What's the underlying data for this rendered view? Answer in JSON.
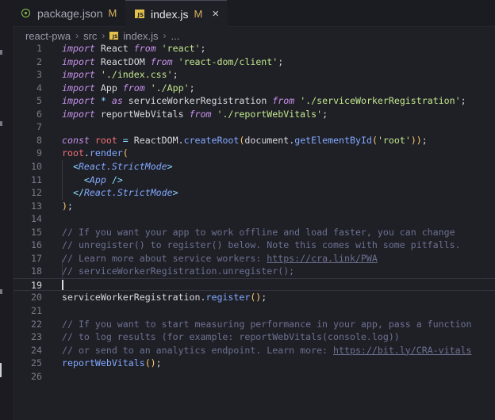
{
  "tabs": [
    {
      "label": "package.json",
      "status": "M",
      "icon": "node-icon"
    },
    {
      "label": "index.js",
      "status": "M",
      "icon": "js-icon",
      "active": true,
      "close": "×"
    }
  ],
  "breadcrumb": {
    "items": [
      "react-pwa",
      "src",
      "index.js",
      "..."
    ],
    "separator": "›"
  },
  "editor": {
    "current_line": 19,
    "lines": [
      {
        "n": "1",
        "tokens": [
          [
            "kw",
            "import"
          ],
          [
            "pl",
            " React "
          ],
          [
            "kw",
            "from"
          ],
          [
            "pl",
            " "
          ],
          [
            "st",
            "'react'"
          ],
          [
            "pl",
            ";"
          ]
        ]
      },
      {
        "n": "2",
        "tokens": [
          [
            "kw",
            "import"
          ],
          [
            "pl",
            " ReactDOM "
          ],
          [
            "kw",
            "from"
          ],
          [
            "pl",
            " "
          ],
          [
            "st",
            "'react-dom/client'"
          ],
          [
            "pl",
            ";"
          ]
        ]
      },
      {
        "n": "3",
        "tokens": [
          [
            "kw",
            "import"
          ],
          [
            "pl",
            " "
          ],
          [
            "st",
            "'./index.css'"
          ],
          [
            "pl",
            ";"
          ]
        ]
      },
      {
        "n": "4",
        "tokens": [
          [
            "kw",
            "import"
          ],
          [
            "pl",
            " App "
          ],
          [
            "kw",
            "from"
          ],
          [
            "pl",
            " "
          ],
          [
            "st",
            "'./App'"
          ],
          [
            "pl",
            ";"
          ]
        ]
      },
      {
        "n": "5",
        "tokens": [
          [
            "kw",
            "import"
          ],
          [
            "pl",
            " "
          ],
          [
            "op",
            "*"
          ],
          [
            "pl",
            " "
          ],
          [
            "kw",
            "as"
          ],
          [
            "pl",
            " serviceWorkerRegistration "
          ],
          [
            "kw",
            "from"
          ],
          [
            "pl",
            " "
          ],
          [
            "st",
            "'./serviceWorkerRegistration'"
          ],
          [
            "pl",
            ";"
          ]
        ]
      },
      {
        "n": "6",
        "tokens": [
          [
            "kw",
            "import"
          ],
          [
            "pl",
            " reportWebVitals "
          ],
          [
            "kw",
            "from"
          ],
          [
            "pl",
            " "
          ],
          [
            "st",
            "'./reportWebVitals'"
          ],
          [
            "pl",
            ";"
          ]
        ]
      },
      {
        "n": "7",
        "tokens": []
      },
      {
        "n": "8",
        "tokens": [
          [
            "kw",
            "const"
          ],
          [
            "pl",
            " "
          ],
          [
            "va",
            "root"
          ],
          [
            "pl",
            " "
          ],
          [
            "op",
            "="
          ],
          [
            "pl",
            " ReactDOM."
          ],
          [
            "fn",
            "createRoot"
          ],
          [
            "br",
            "("
          ],
          [
            "pl",
            "document."
          ],
          [
            "fn",
            "getElementById"
          ],
          [
            "br",
            "("
          ],
          [
            "st",
            "'root'"
          ],
          [
            "br",
            "))"
          ],
          [
            "pl",
            ";"
          ]
        ]
      },
      {
        "n": "9",
        "tokens": [
          [
            "va",
            "root"
          ],
          [
            "pl",
            "."
          ],
          [
            "fn",
            "render"
          ],
          [
            "br",
            "("
          ]
        ]
      },
      {
        "n": "10",
        "tokens": [
          [
            "pl",
            "  "
          ],
          [
            "pn",
            "<"
          ],
          [
            "tg",
            "React.StrictMode"
          ],
          [
            "pn",
            ">"
          ]
        ]
      },
      {
        "n": "11",
        "tokens": [
          [
            "pl",
            "    "
          ],
          [
            "pn",
            "<"
          ],
          [
            "tg",
            "App"
          ],
          [
            "pl",
            " "
          ],
          [
            "pn",
            "/>"
          ]
        ]
      },
      {
        "n": "12",
        "tokens": [
          [
            "pl",
            "  "
          ],
          [
            "pn",
            "</"
          ],
          [
            "tg",
            "React.StrictMode"
          ],
          [
            "pn",
            ">"
          ]
        ]
      },
      {
        "n": "13",
        "tokens": [
          [
            "br",
            ")"
          ],
          [
            "pl",
            ";"
          ]
        ]
      },
      {
        "n": "14",
        "tokens": []
      },
      {
        "n": "15",
        "tokens": [
          [
            "cm",
            "// If you want your app to work offline and load faster, you can change"
          ]
        ]
      },
      {
        "n": "16",
        "tokens": [
          [
            "cm",
            "// unregister() to register() below. Note this comes with some pitfalls."
          ]
        ]
      },
      {
        "n": "17",
        "tokens": [
          [
            "cm",
            "// Learn more about service workers: "
          ],
          [
            "cm ul",
            "https://cra.link/PWA"
          ]
        ]
      },
      {
        "n": "18",
        "tokens": [
          [
            "cm",
            "// serviceWorkerRegistration.unregister();"
          ]
        ]
      },
      {
        "n": "19",
        "tokens": []
      },
      {
        "n": "20",
        "tokens": [
          [
            "pl",
            "serviceWorkerRegistration."
          ],
          [
            "fn",
            "register"
          ],
          [
            "br",
            "()"
          ],
          [
            "pl",
            ";"
          ]
        ]
      },
      {
        "n": "21",
        "tokens": []
      },
      {
        "n": "22",
        "tokens": [
          [
            "cm",
            "// If you want to start measuring performance in your app, pass a function"
          ]
        ]
      },
      {
        "n": "23",
        "tokens": [
          [
            "cm",
            "// to log results (for example: reportWebVitals(console.log))"
          ]
        ]
      },
      {
        "n": "24",
        "tokens": [
          [
            "cm",
            "// or send to an analytics endpoint. Learn more: "
          ],
          [
            "cm ul",
            "https://bit.ly/CRA-vitals"
          ]
        ]
      },
      {
        "n": "25",
        "tokens": [
          [
            "fn",
            "reportWebVitals"
          ],
          [
            "br",
            "()"
          ],
          [
            "pl",
            ";"
          ]
        ]
      },
      {
        "n": "26",
        "tokens": []
      }
    ]
  }
}
